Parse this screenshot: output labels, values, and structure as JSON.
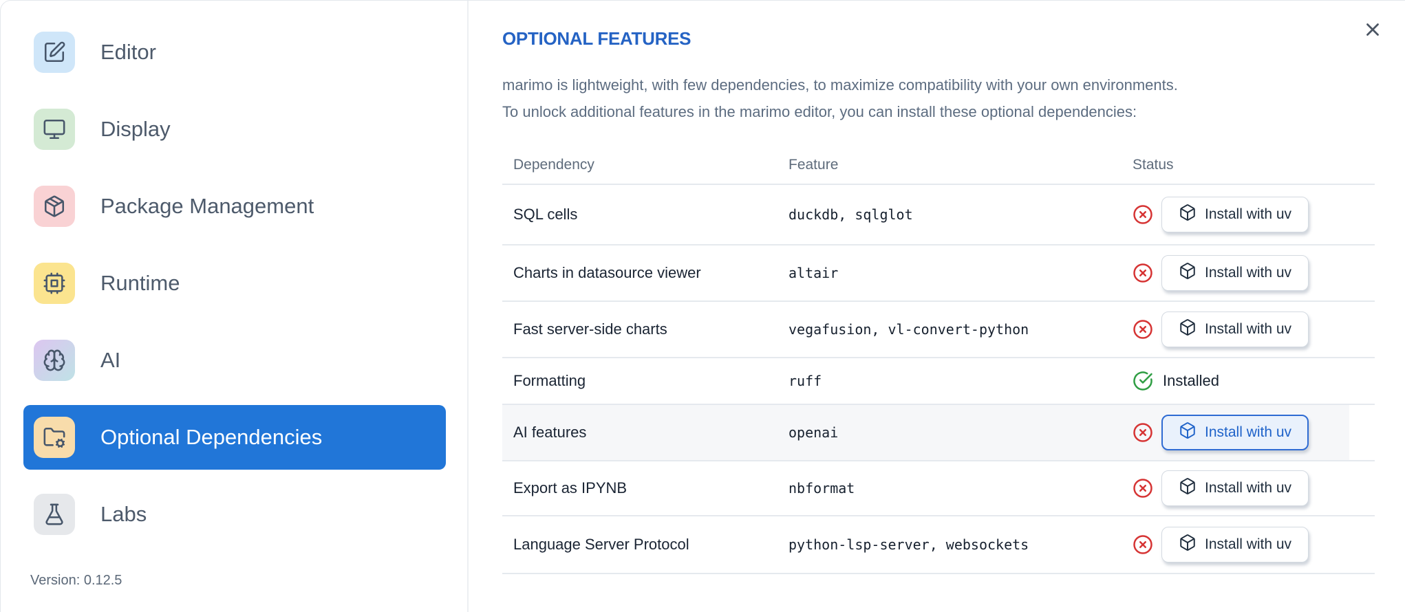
{
  "sidebar": {
    "items": [
      {
        "label": "Editor",
        "icon": "square-pen-icon"
      },
      {
        "label": "Display",
        "icon": "monitor-icon"
      },
      {
        "label": "Package Management",
        "icon": "package-icon"
      },
      {
        "label": "Runtime",
        "icon": "cpu-icon"
      },
      {
        "label": "AI",
        "icon": "brain-icon"
      },
      {
        "label": "Optional Dependencies",
        "icon": "folder-cog-icon"
      },
      {
        "label": "Labs",
        "icon": "flask-icon"
      }
    ],
    "selected_index": 5,
    "version_label": "Version: 0.12.5"
  },
  "panel": {
    "title": "OPTIONAL FEATURES",
    "description_line1": "marimo is lightweight, with few dependencies, to maximize compatibility with your own environments.",
    "description_line2": "To unlock additional features in the marimo editor, you can install these optional dependencies:",
    "close_icon": "x-icon",
    "table": {
      "columns": [
        "Dependency",
        "Feature",
        "Status"
      ],
      "install_button_label": "Install with uv",
      "installed_label": "Installed",
      "rows": [
        {
          "dependency": "SQL cells",
          "feature": "duckdb, sqlglot",
          "installed": false,
          "highlighted": false
        },
        {
          "dependency": "Charts in datasource viewer",
          "feature": "altair",
          "installed": false,
          "highlighted": false
        },
        {
          "dependency": "Fast server-side charts",
          "feature": "vegafusion, vl-convert-python",
          "installed": false,
          "highlighted": false
        },
        {
          "dependency": "Formatting",
          "feature": "ruff",
          "installed": true,
          "highlighted": false
        },
        {
          "dependency": "AI features",
          "feature": "openai",
          "installed": false,
          "highlighted": true
        },
        {
          "dependency": "Export as IPYNB",
          "feature": "nbformat",
          "installed": false,
          "highlighted": false
        },
        {
          "dependency": "Language Server Protocol",
          "feature": "python-lsp-server, websockets",
          "installed": false,
          "highlighted": false
        }
      ]
    }
  },
  "colors": {
    "accent_blue": "#2176d8",
    "title_blue": "#2563c4",
    "error_red": "#d63434",
    "success_green": "#2f9e44",
    "focused_button_border": "#2e6bd3"
  }
}
